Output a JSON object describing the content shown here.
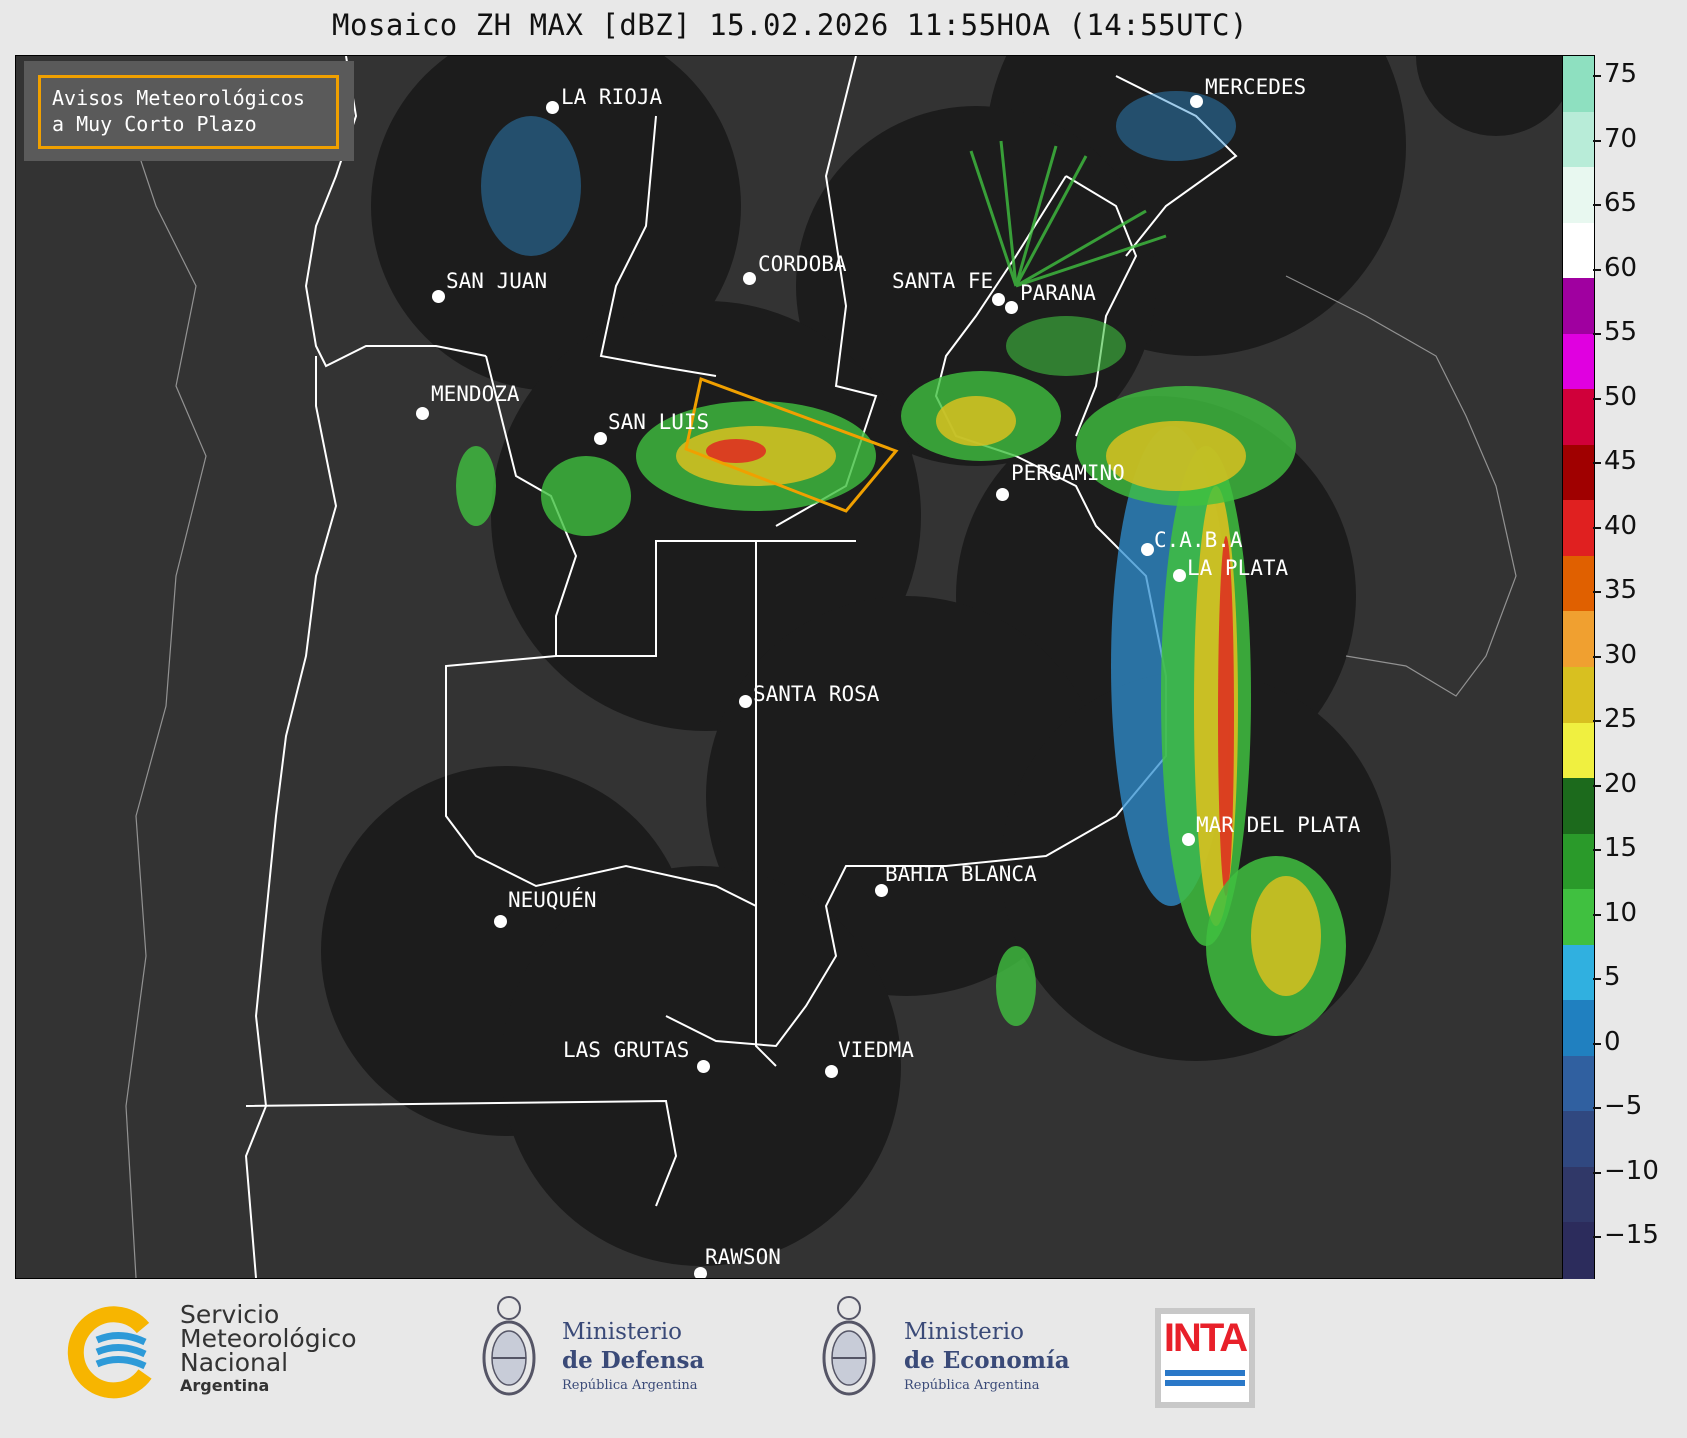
{
  "title": "Mosaico ZH MAX [dBZ] 15.02.2026 11:55HOA (14:55UTC)",
  "warning_box": {
    "line1": "Avisos Meteorológicos",
    "line2": "a Muy Corto Plazo"
  },
  "colorbar": {
    "unit": "dBZ",
    "ticks": [
      "75",
      "70",
      "65",
      "60",
      "55",
      "50",
      "45",
      "40",
      "35",
      "30",
      "25",
      "20",
      "15",
      "10",
      "5",
      "0",
      "−5",
      "−10",
      "−15"
    ],
    "colors": [
      "#8ee0c0",
      "#b8ecd8",
      "#e8f8f0",
      "#ffffff",
      "#a000a0",
      "#e000e0",
      "#d0003a",
      "#a00000",
      "#e02020",
      "#e06000",
      "#f0a030",
      "#d8c020",
      "#f0f040",
      "#1c6a1c",
      "#2a9a2a",
      "#40c040",
      "#30b0e0",
      "#2080c0",
      "#3060a0",
      "#304880",
      "#303868",
      "#2c2c5c"
    ]
  },
  "cities": [
    {
      "name": "LA RIOJA",
      "icon": "city-dot"
    },
    {
      "name": "CORDOBA",
      "icon": "city-dot"
    },
    {
      "name": "SAN JUAN",
      "icon": "city-dot"
    },
    {
      "name": "SANTA FE",
      "icon": "city-dot"
    },
    {
      "name": "PARANA",
      "icon": "city-dot"
    },
    {
      "name": "MERCEDES",
      "icon": "city-dot"
    },
    {
      "name": "MENDOZA",
      "icon": "city-dot"
    },
    {
      "name": "SAN LUIS",
      "icon": "city-dot"
    },
    {
      "name": "PERGAMINO",
      "icon": "city-dot"
    },
    {
      "name": "C.A.B.A",
      "icon": "city-dot"
    },
    {
      "name": "LA PLATA",
      "icon": "city-dot"
    },
    {
      "name": "SANTA ROSA",
      "icon": "city-dot"
    },
    {
      "name": "MAR DEL PLATA",
      "icon": "city-dot"
    },
    {
      "name": "BAHIA BLANCA",
      "icon": "city-dot"
    },
    {
      "name": "NEUQUÉN",
      "icon": "city-dot"
    },
    {
      "name": "LAS GRUTAS",
      "icon": "city-dot"
    },
    {
      "name": "VIEDMA",
      "icon": "city-dot"
    },
    {
      "name": "RAWSON",
      "icon": "city-dot"
    }
  ],
  "footer": {
    "smn": {
      "line1": "Servicio",
      "line2": "Meteorológico",
      "line3": "Nacional",
      "line4": "Argentina",
      "icon": "smn-logo-icon"
    },
    "defensa": {
      "line1": "Ministerio",
      "line2": "de Defensa",
      "line3": "República Argentina",
      "icon": "coat-of-arms-icon"
    },
    "economia": {
      "line1": "Ministerio",
      "line2": "de Economía",
      "line3": "República Argentina",
      "icon": "coat-of-arms-icon"
    },
    "inta": {
      "text": "INTA",
      "icon": "inta-logo-icon"
    }
  }
}
